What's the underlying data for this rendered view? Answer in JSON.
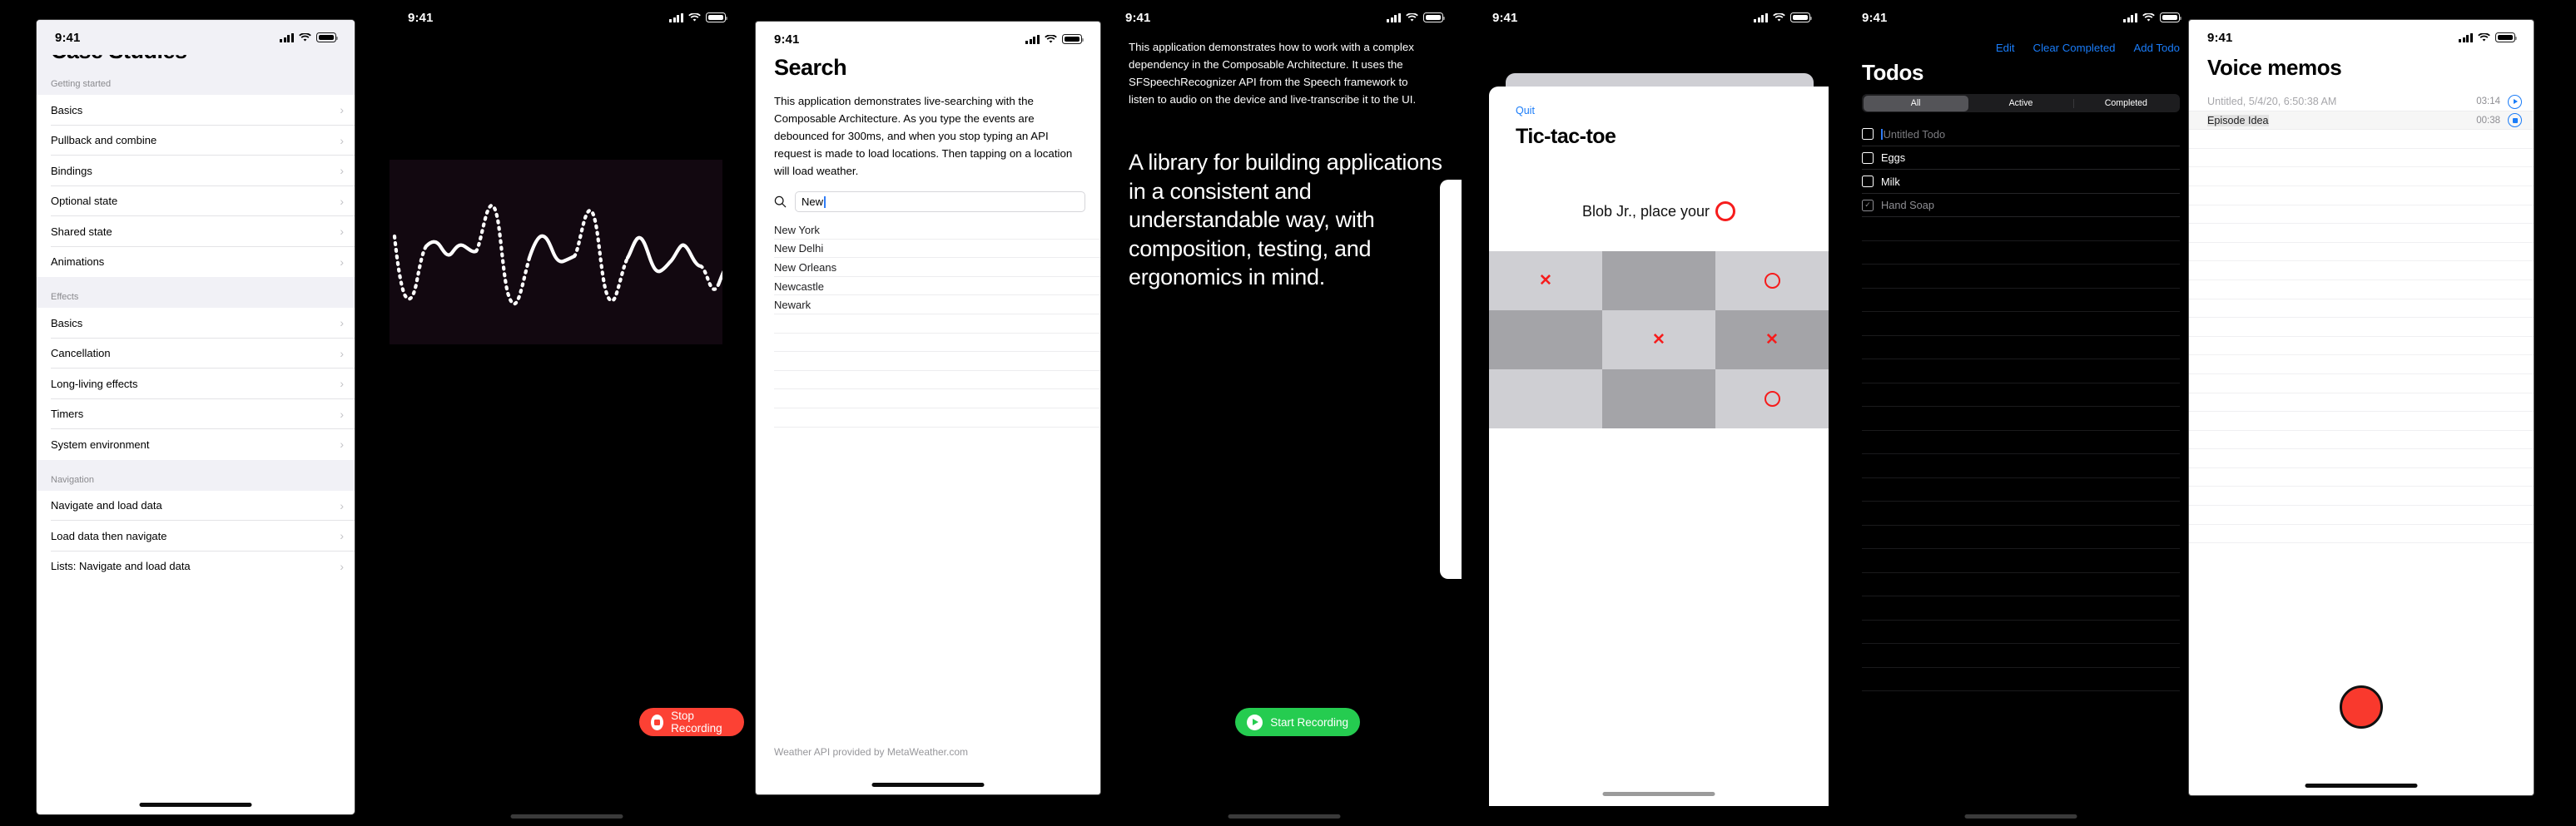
{
  "status_bar": {
    "time": "9:41",
    "signal_icon": "cellular-bars-icon",
    "wifi_icon": "wifi-icon",
    "battery_icon": "battery-icon"
  },
  "colors": {
    "accent_blue": "#1a7cf8",
    "record_red": "#fc4134",
    "start_green": "#25cc50",
    "mark_red": "#f61c1c",
    "ios_grouped_bg": "#f1f1f6"
  },
  "phone1_case_studies": {
    "title": "Case Studies",
    "sections": [
      {
        "header": "Getting started",
        "items": [
          "Basics",
          "Pullback and combine",
          "Bindings",
          "Optional state",
          "Shared state",
          "Animations"
        ]
      },
      {
        "header": "Effects",
        "items": [
          "Basics",
          "Cancellation",
          "Long-living effects",
          "Timers",
          "System environment"
        ]
      },
      {
        "header": "Navigation",
        "items": [
          "Navigate and load data",
          "Load data then navigate",
          "Lists: Navigate and load data"
        ]
      }
    ],
    "chevron": "›"
  },
  "phone2_recording": {
    "waveform_label": "audio-waveform",
    "button": {
      "label": "Stop Recording",
      "icon": "stop-icon"
    }
  },
  "phone3_search": {
    "title": "Search",
    "blurb": "This application demonstrates live-searching with the Composable Architecture. As you type the events are debounced for 300ms, and when you stop typing an API request is made to load locations. Then tapping on a location will load weather.",
    "search": {
      "value": "New",
      "placeholder": "New",
      "icon": "search-icon"
    },
    "results": [
      "New York",
      "New Delhi",
      "New Orleans",
      "Newcastle",
      "Newark"
    ],
    "footer": "Weather API provided by MetaWeather.com"
  },
  "phone4_speech": {
    "blurb": "This application demonstrates how to work with a complex dependency in the Composable Architecture. It uses the SFSpeechRecognizer API from the Speech framework to listen to audio on the device and live-transcribe it to the UI.",
    "transcription": "A library for building applications in a consistent and understandable way, with composition, testing, and ergonomics in mind.",
    "button": {
      "label": "Start Recording",
      "icon": "play-icon"
    }
  },
  "phone5_tictactoe": {
    "quit_label": "Quit",
    "title": "Tic-tac-toe",
    "status_prefix": "Blob Jr., place your",
    "status_mark": "O",
    "board": [
      [
        {
          "mark": "X",
          "shade": "lite"
        },
        {
          "mark": "",
          "shade": "dk"
        },
        {
          "mark": "O",
          "shade": "lite"
        }
      ],
      [
        {
          "mark": "",
          "shade": "dk"
        },
        {
          "mark": "X",
          "shade": "lite"
        },
        {
          "mark": "X",
          "shade": "dk"
        }
      ],
      [
        {
          "mark": "",
          "shade": "lite"
        },
        {
          "mark": "",
          "shade": "dk"
        },
        {
          "mark": "O",
          "shade": "lite"
        }
      ]
    ]
  },
  "phone6_todos": {
    "nav": [
      "Edit",
      "Clear Completed",
      "Add Todo"
    ],
    "title": "Todos",
    "filters": [
      "All",
      "Active",
      "Completed"
    ],
    "selected_filter": "All",
    "items": [
      {
        "label": "Untitled Todo",
        "done": false,
        "placeholder": true,
        "editing": true
      },
      {
        "label": "Eggs",
        "done": false,
        "placeholder": false,
        "editing": false
      },
      {
        "label": "Milk",
        "done": false,
        "placeholder": false,
        "editing": false
      },
      {
        "label": "Hand Soap",
        "done": true,
        "placeholder": false,
        "editing": false
      }
    ],
    "check_glyph": "✓"
  },
  "phone7_voice_memos": {
    "title": "Voice memos",
    "memos": [
      {
        "name": "Untitled, 5/4/20, 6:50:38 AM",
        "duration": "03:14",
        "state": "play",
        "muted": true,
        "selected": false
      },
      {
        "name": "Episode Idea",
        "duration": "00:38",
        "state": "stop",
        "muted": false,
        "selected": true
      }
    ],
    "record_button": "record-button"
  }
}
